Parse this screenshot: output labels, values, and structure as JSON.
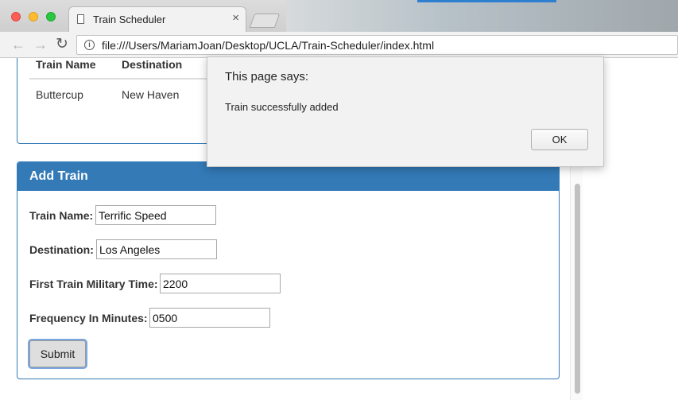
{
  "browser": {
    "tab_title": "Train Scheduler",
    "tab_close": "×",
    "url": "file:///Users/MariamJoan/Desktop/UCLA/Train-Scheduler/index.html",
    "info_symbol": "i"
  },
  "trains_table": {
    "headers": [
      "Train Name",
      "Destination"
    ],
    "rows": [
      [
        "Buttercup",
        "New Haven"
      ]
    ]
  },
  "add_train": {
    "title": "Add Train",
    "fields": {
      "train_name": {
        "label": "Train Name:",
        "value": "Terrific Speed"
      },
      "destination": {
        "label": "Destination:",
        "value": "Los Angeles"
      },
      "first_time": {
        "label": "First Train Military Time:",
        "value": "2200"
      },
      "frequency": {
        "label": "Frequency In Minutes:",
        "value": "0500"
      }
    },
    "submit_label": "Submit"
  },
  "dialog": {
    "title": "This page says:",
    "message": "Train successfully added",
    "ok_label": "OK"
  },
  "colors": {
    "panel_primary": "#337ab7"
  }
}
